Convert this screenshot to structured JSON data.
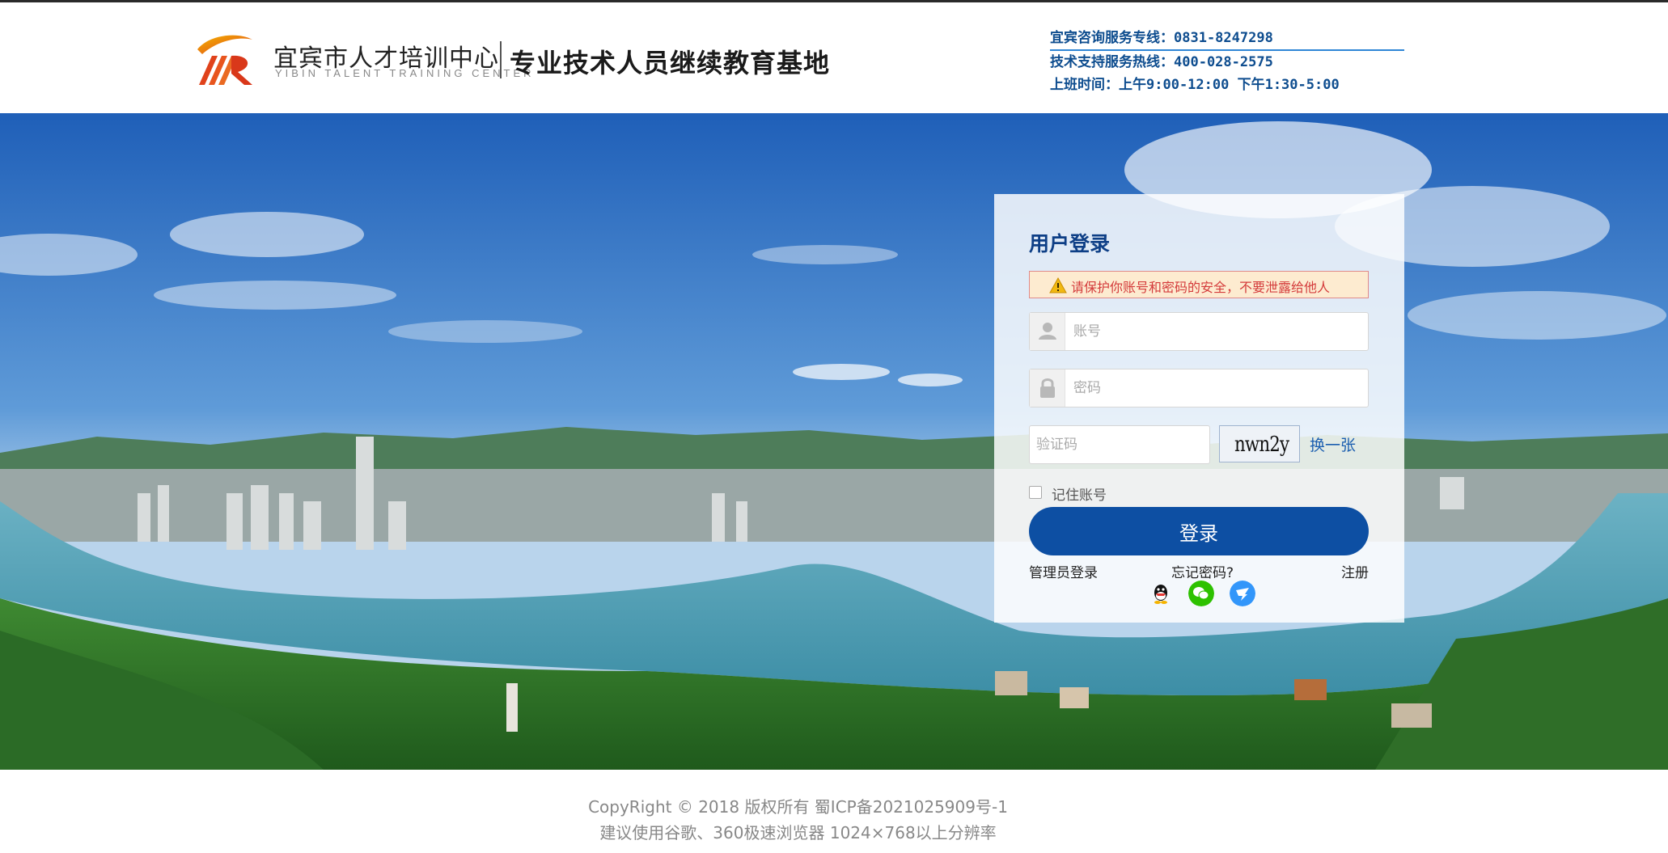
{
  "header": {
    "brand_cn": "宜宾市人才培训中心",
    "brand_en": "YIBIN TALENT TRAINING CENTER",
    "subtitle": "专业技术人员继续教育基地",
    "contact": {
      "consult": "宜宾咨询服务专线：0831-8247298",
      "support": "技术支持服务热线：400-028-2575",
      "hours": "上班时间：上午9:00-12:00 下午1:30-5:00"
    }
  },
  "login": {
    "title": "用户登录",
    "warning": "请保护你账号和密码的安全，不要泄露给他人",
    "account_placeholder": "账号",
    "password_placeholder": "密码",
    "captcha_placeholder": "验证码",
    "captcha_code": "nwn2y",
    "captcha_refresh": "换一张",
    "remember": "记住账号",
    "remember_checked": false,
    "submit": "登录",
    "admin_login": "管理员登录",
    "forgot_password": "忘记密码?",
    "register": "注册",
    "social": [
      "qq-icon",
      "wechat-icon",
      "dingtalk-icon"
    ]
  },
  "footer": {
    "copyright": "CopyRight © 2018 版权所有 蜀ICP备2021025909号-1",
    "browser_tip": "建议使用谷歌、360极速浏览器 1024×768以上分辨率"
  },
  "colors": {
    "primary": "#0d4fa3",
    "title": "#0e3f86",
    "warning_text": "#d43b3b",
    "contact_text": "#0e4d8f"
  }
}
